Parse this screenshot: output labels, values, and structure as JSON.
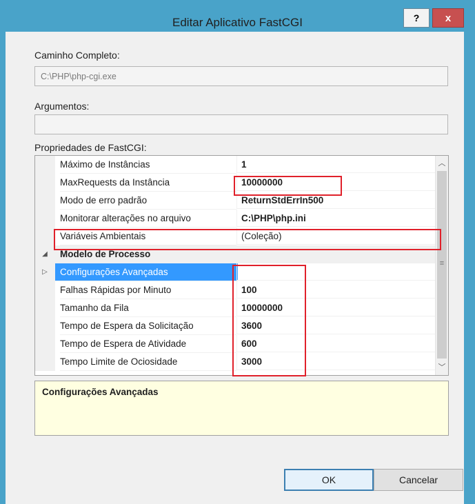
{
  "dialog": {
    "title": "Editar Aplicativo FastCGI",
    "help_label": "?",
    "close_label": "x"
  },
  "full_path": {
    "label": "Caminho Completo:",
    "value": "C:\\PHP\\php-cgi.exe"
  },
  "arguments": {
    "label": "Argumentos:",
    "value": ""
  },
  "properties": {
    "label": "Propriedades de FastCGI:",
    "rows": [
      {
        "name": "Máximo de Instâncias",
        "value": "1"
      },
      {
        "name": "MaxRequests da Instância",
        "value": "10000000"
      },
      {
        "name": "Modo de erro padrão",
        "value": "ReturnStdErrIn500"
      },
      {
        "name": "Monitorar alterações no arquivo",
        "value": "C:\\PHP\\php.ini"
      },
      {
        "name": "Variáveis Ambientais",
        "value": "(Coleção)"
      },
      {
        "name": "Modelo de Processo",
        "value": ""
      },
      {
        "name": "Configurações Avançadas",
        "value": ""
      },
      {
        "name": "Falhas Rápidas por Minuto",
        "value": "100"
      },
      {
        "name": "Tamanho da Fila",
        "value": "10000000"
      },
      {
        "name": "Tempo de Espera da Solicitação",
        "value": "3600"
      },
      {
        "name": "Tempo de Espera de Atividade",
        "value": "600"
      },
      {
        "name": "Tempo Limite de Ociosidade",
        "value": "3000"
      }
    ],
    "category_expander": "◢",
    "collapsed_expander": "▷",
    "scroll_up": "︿",
    "scroll_down": "﹀",
    "scroll_grip": "≡"
  },
  "description": {
    "text": "Configurações Avançadas"
  },
  "buttons": {
    "ok": "OK",
    "cancel": "Cancelar"
  },
  "colors": {
    "titlebar": "#49a3c9",
    "close_button": "#c75050",
    "selection": "#3399ff",
    "highlight_box": "#e0202a",
    "description_bg": "#ffffe1"
  }
}
